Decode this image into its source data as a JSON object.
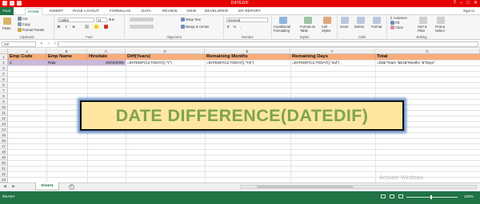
{
  "window": {
    "title": "DATEDIF",
    "controls": [
      "?",
      "–",
      "□",
      "✕"
    ]
  },
  "ribbon_tabs": {
    "file": "FILE",
    "home": "HOME",
    "insert": "INSERT",
    "page_layout": "PAGE LAYOUT",
    "formulas": "FORMULAS",
    "data": "DATA",
    "review": "REVIEW",
    "view": "VIEW",
    "developer": "DEVELOPER",
    "my_report": "MY REPORT",
    "sign_in": "Sign in"
  },
  "clipboard": {
    "cut": "Cut",
    "copy": "Copy",
    "format_painter": "Format Painter",
    "paste": "Paste",
    "label": "Clipboard"
  },
  "font": {
    "name": "Calibri",
    "size": "11",
    "label": "Font"
  },
  "alignment": {
    "wrap_text": "Wrap Text",
    "merge_center": "Merge & Center",
    "label": "Alignment"
  },
  "number": {
    "format": "General",
    "label": "Number"
  },
  "styles": {
    "conditional": "Conditional",
    "conditional2": "Formatting",
    "format_as": "Format as",
    "table": "Table",
    "cell": "Cell",
    "styles2": "Styles",
    "label": "Styles"
  },
  "cells": {
    "insert": "Insert",
    "delete": "Delete",
    "format": "Format",
    "label": "Cells"
  },
  "editing": {
    "autosum": "AutoSum",
    "fill": "Fill",
    "clear": "Clear",
    "sort": "Sort &",
    "filter": "Filter",
    "find": "Find &",
    "select": "Select",
    "label": "Editing"
  },
  "formula_bar": {
    "cell_ref": "A3",
    "fx_buttons": "✕ ✓ fx",
    "content": ""
  },
  "columns": [
    "A",
    "B",
    "C",
    "D",
    "E",
    "F",
    "G"
  ],
  "rows": [
    "1",
    "2",
    "3",
    "4",
    "5",
    "6",
    "7",
    "8",
    "9",
    "10",
    "11",
    "12",
    "13",
    "14",
    "15",
    "16",
    "17",
    "18",
    "19",
    "20",
    "21",
    "22",
    "23"
  ],
  "headers": [
    "Emp Code",
    "Emp Name",
    "Hiredate",
    "Diff(Years)",
    "Remaining Months",
    "Remaining Days",
    "Total"
  ],
  "row2": [
    "1",
    "Raja",
    "20/04/2005",
    "=DATEDIF(C2,TODAY(),\"Y\")",
    "=DATEDIF(C2,TODAY(),\"Ym\")",
    "=DATEDIF(C2,TODAY(),\"md\")",
    "=D2&\"Years \"&E2&\"Months \"&\"Days\""
  ],
  "banner": "DATE DIFFERENCE(DATEDIF)",
  "sheet": {
    "tab": "Sheet1",
    "add": "+",
    "nav": "◀ ▶"
  },
  "watermark": {
    "title": "Activate Windows",
    "sub": "Go to Settings to activate Windows."
  },
  "status": {
    "ready": "READY",
    "zoom": "100%"
  },
  "colors": {
    "header_fill": "#f7ad7a",
    "data_fill": "#c9b8d8",
    "banner_fill": "#ffe7a1",
    "banner_text": "#7ea34a",
    "excel_green": "#217346",
    "title_red": "#e60000"
  }
}
